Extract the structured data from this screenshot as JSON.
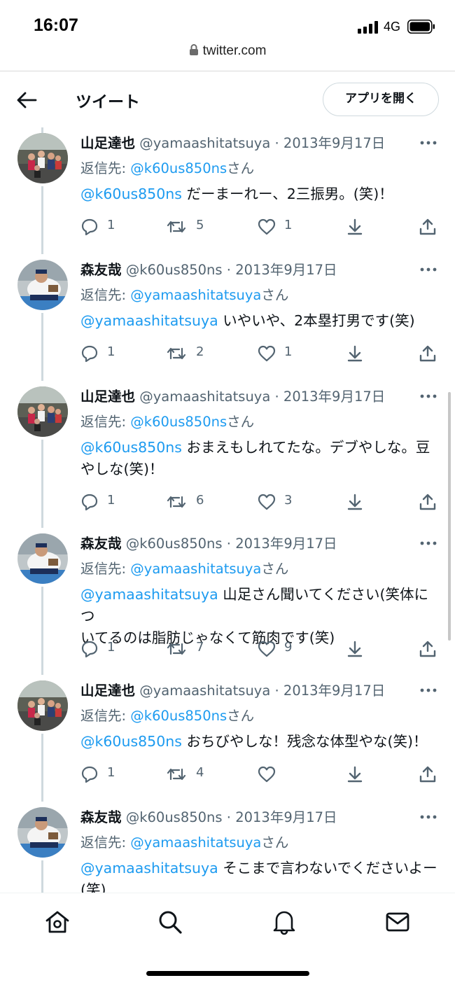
{
  "status_bar": {
    "time": "16:07",
    "network": "4G"
  },
  "url_bar": {
    "domain": "twitter.com"
  },
  "header": {
    "title": "ツイート",
    "open_app_label": "アプリを開く"
  },
  "tweets": [
    {
      "name": "山足達也",
      "handle": "@yamaashitatsuya",
      "date": "2013年9月17日",
      "reply_label": "返信先: ",
      "reply_to": "@k60us850ns",
      "reply_suffix": "さん",
      "mention": "@k60us850ns",
      "text": " だーまーれー、2三振男。(笑)！",
      "replies": "1",
      "retweets": "5",
      "likes": "1",
      "avatar": "group"
    },
    {
      "name": "森友哉",
      "handle": "@k60us850ns",
      "date": "2013年9月17日",
      "reply_label": "返信先: ",
      "reply_to": "@yamaashitatsuya",
      "reply_suffix": "さん",
      "mention": "@yamaashitatsuya",
      "text": " いやいや、2本塁打男です(笑)",
      "replies": "1",
      "retweets": "2",
      "likes": "1",
      "avatar": "player"
    },
    {
      "name": "山足達也",
      "handle": "@yamaashitatsuya",
      "date": "2013年9月17日",
      "reply_label": "返信先: ",
      "reply_to": "@k60us850ns",
      "reply_suffix": "さん",
      "mention": "@k60us850ns",
      "text": " おまえもしれてたな。デブやしな。豆やしな(笑)！",
      "replies": "1",
      "retweets": "6",
      "likes": "3",
      "avatar": "group"
    },
    {
      "name": "森友哉",
      "handle": "@k60us850ns",
      "date": "2013年9月17日",
      "reply_label": "返信先: ",
      "reply_to": "@yamaashitatsuya",
      "reply_suffix": "さん",
      "mention": "@yamaashitatsuya",
      "text": " 山足さん聞いてください(笑体についてるのは脂肪じゃなくて筋肉です(笑)",
      "replies": "1",
      "retweets": "7",
      "likes": "9",
      "avatar": "player"
    },
    {
      "name": "山足達也",
      "handle": "@yamaashitatsuya",
      "date": "2013年9月17日",
      "reply_label": "返信先: ",
      "reply_to": "@k60us850ns",
      "reply_suffix": "さん",
      "mention": "@k60us850ns",
      "text": " おちびやしな！残念な体型やな(笑)！",
      "replies": "1",
      "retweets": "4",
      "likes": "",
      "avatar": "group"
    },
    {
      "name": "森友哉",
      "handle": "@k60us850ns",
      "date": "2013年9月17日",
      "reply_label": "返信先: ",
      "reply_to": "@yamaashitatsuya",
      "reply_suffix": "さん",
      "mention": "@yamaashitatsuya",
      "text": " そこまで言わないでくださいよー(笑)",
      "replies": "",
      "retweets": "",
      "likes": "",
      "avatar": "player"
    }
  ],
  "colors": {
    "link": "#1d9bf0",
    "secondary_text": "#536471",
    "thread_line": "#cfd9de",
    "primary_text": "#0f1419"
  },
  "icons": {
    "tweet_actions": [
      "reply-icon",
      "retweet-icon",
      "like-icon",
      "bookmark-icon",
      "share-icon"
    ],
    "bottom_nav": [
      "home-icon",
      "search-icon",
      "notifications-icon",
      "messages-icon"
    ]
  }
}
